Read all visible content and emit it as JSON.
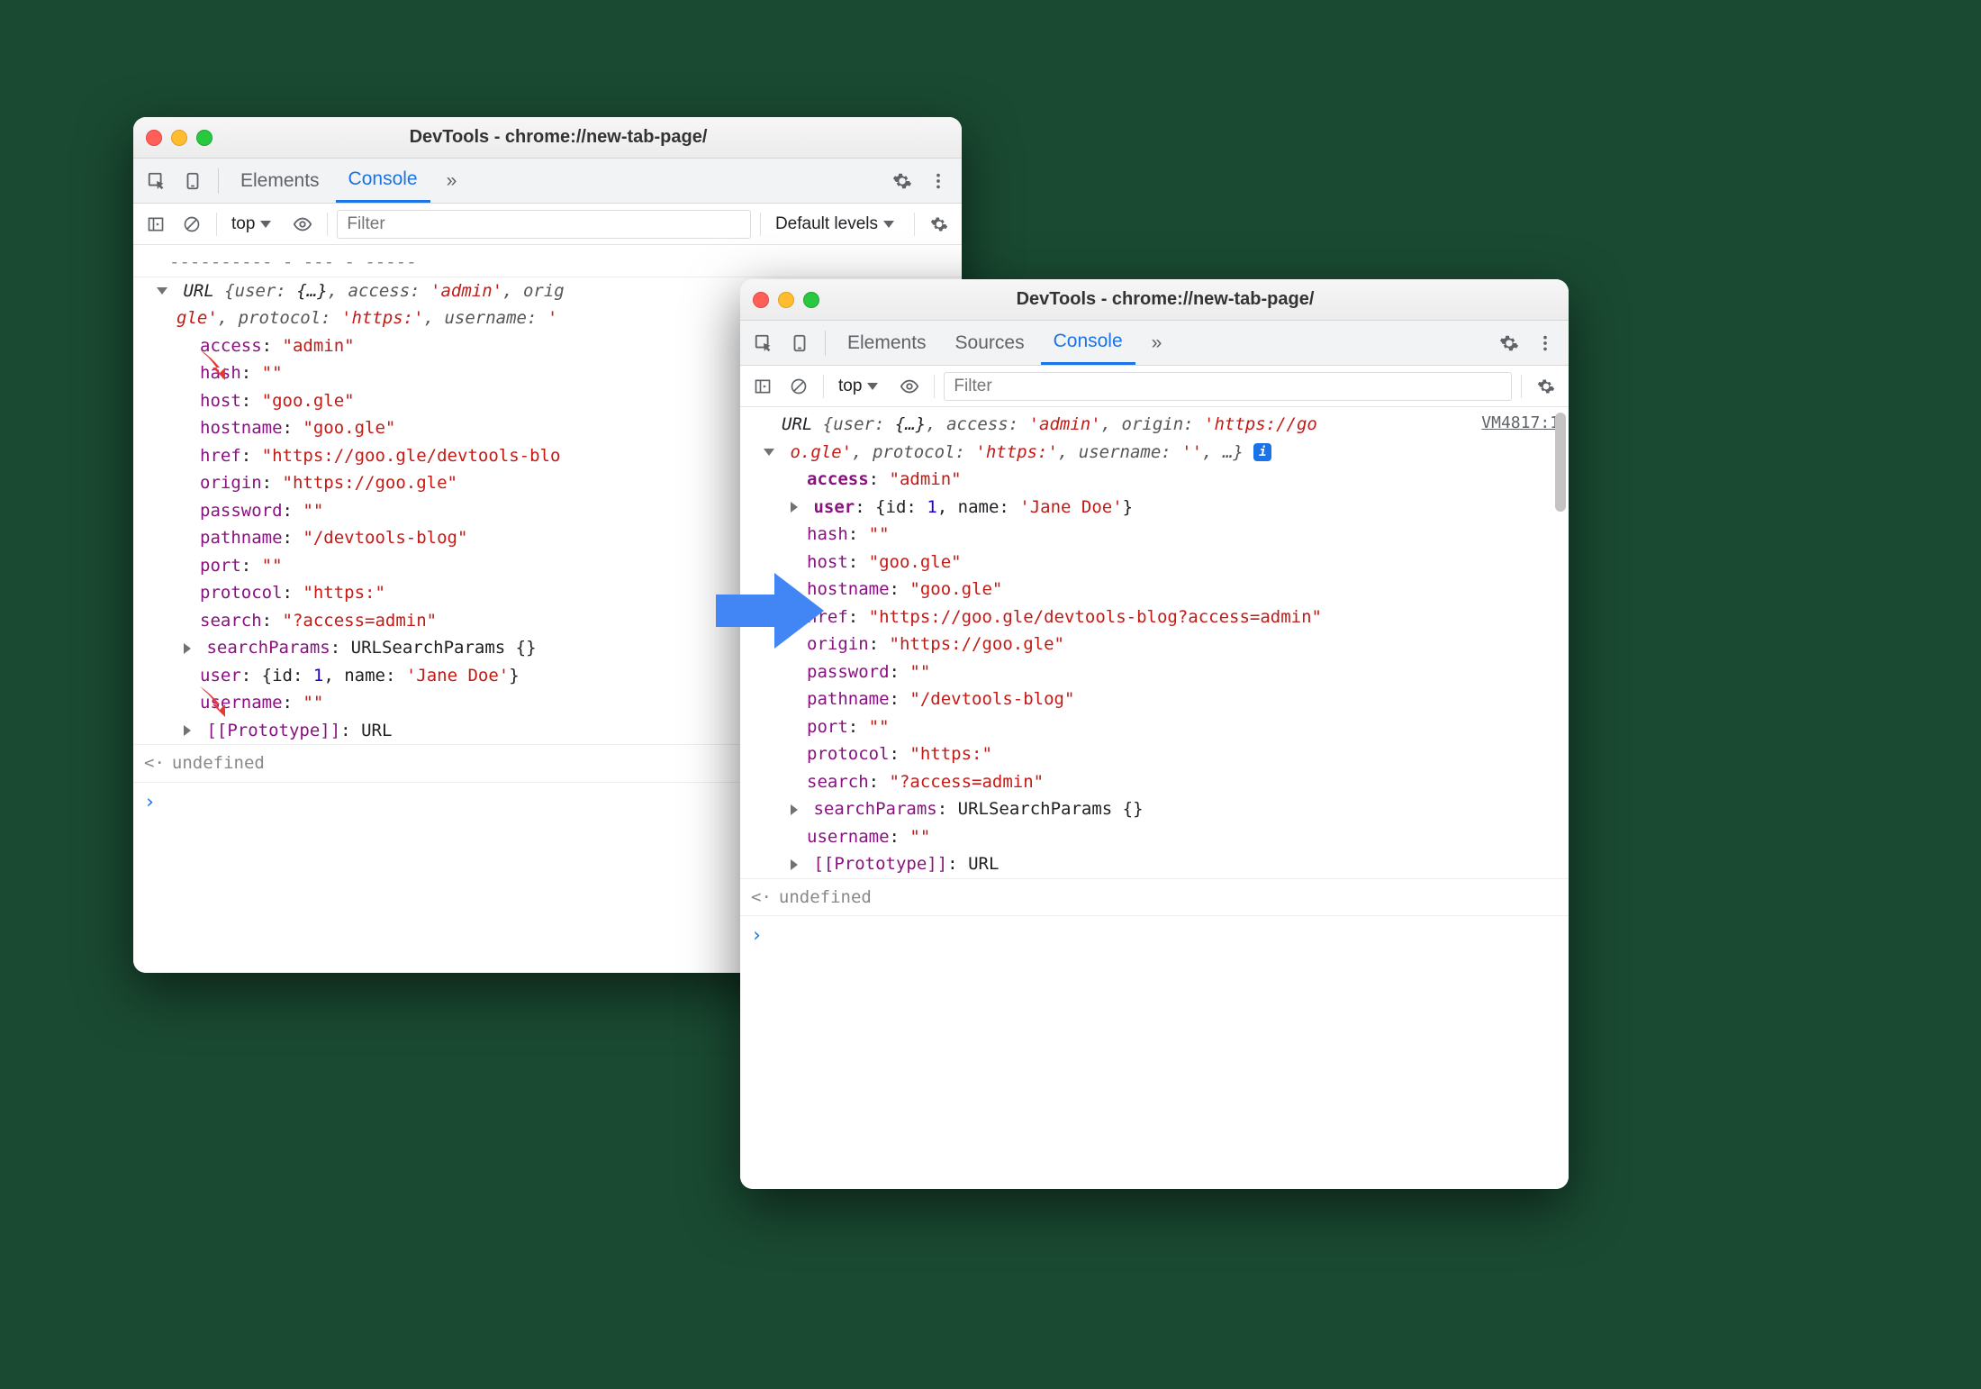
{
  "windowTitle": "DevTools - chrome://new-tab-page/",
  "tabs": {
    "elements": "Elements",
    "sources": "Sources",
    "console": "Console"
  },
  "filter": {
    "placeholder": "Filter",
    "context": "top",
    "levels": "Default levels"
  },
  "sourceLink": "VM4817:1",
  "leftSummary": {
    "type": "URL",
    "line1_parts": [
      "{user: ",
      "{…}",
      ", access: ",
      "'admin'",
      ", orig"
    ],
    "line2_parts": [
      "gle'",
      ", protocol: ",
      "'https:'",
      ", username: ",
      "'"
    ]
  },
  "rightSummary": {
    "type": "URL",
    "line1_parts": [
      "{user: ",
      "{…}",
      ", access: ",
      "'admin'",
      ", origin: ",
      "'https://go"
    ],
    "line2_parts": [
      "o.gle'",
      ", protocol: ",
      "'https:'",
      ", username: ",
      "''",
      ", …}"
    ]
  },
  "props": {
    "access": {
      "key": "access",
      "val": "\"admin\""
    },
    "user": {
      "key": "user",
      "prefix": "{id: ",
      "id": "1",
      "mid": ", name: ",
      "name": "'Jane Doe'",
      "suffix": "}"
    },
    "hash": {
      "key": "hash",
      "val": "\"\""
    },
    "host": {
      "key": "host",
      "val": "\"goo.gle\""
    },
    "hostname": {
      "key": "hostname",
      "val": "\"goo.gle\""
    },
    "hrefShort": {
      "key": "href",
      "val": "\"https://goo.gle/devtools-blo"
    },
    "hrefFull": {
      "key": "href",
      "val": "\"https://goo.gle/devtools-blog?access=admin\""
    },
    "origin": {
      "key": "origin",
      "val": "\"https://goo.gle\""
    },
    "password": {
      "key": "password",
      "val": "\"\""
    },
    "pathname": {
      "key": "pathname",
      "val": "\"/devtools-blog\""
    },
    "port": {
      "key": "port",
      "val": "\"\""
    },
    "protocol": {
      "key": "protocol",
      "val": "\"https:\""
    },
    "search": {
      "key": "search",
      "val": "\"?access=admin\""
    },
    "searchParams": {
      "key": "searchParams",
      "val": "URLSearchParams {}"
    },
    "username": {
      "key": "username",
      "val": "\"\""
    },
    "proto": {
      "key": "[[Prototype]]",
      "val": "URL"
    }
  },
  "undefined": "undefined"
}
